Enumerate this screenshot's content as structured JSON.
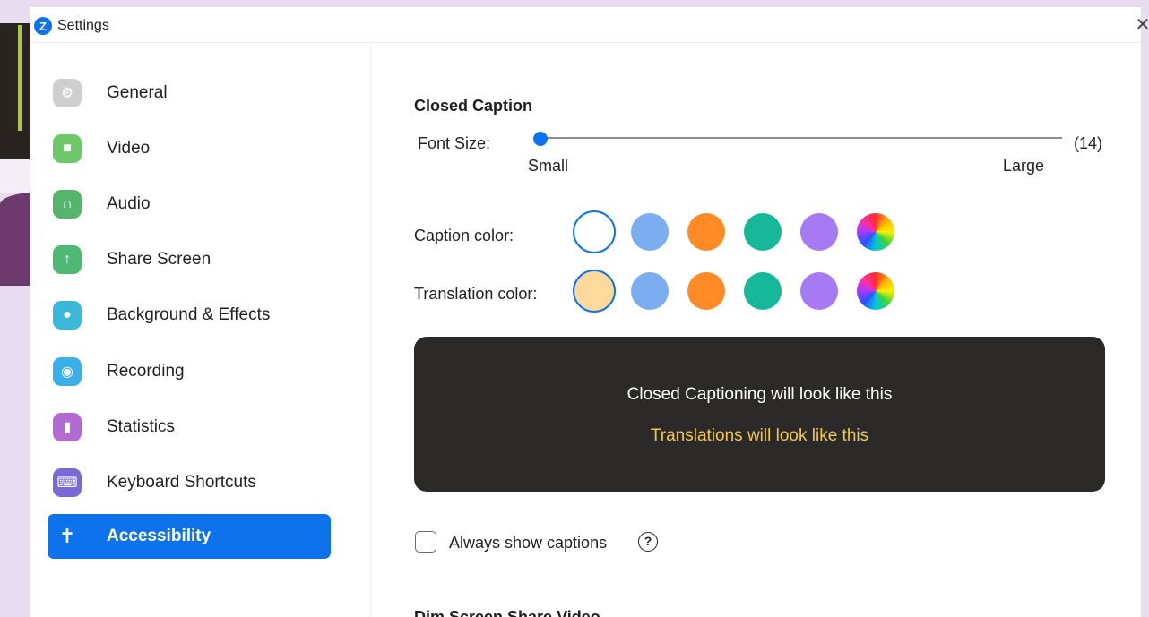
{
  "window": {
    "title": "Settings",
    "logo_letter": "Z",
    "close_glyph": "✕"
  },
  "sidebar": {
    "items": [
      {
        "label": "General",
        "icon": "gear-icon",
        "color": "#cfcfcf",
        "glyph": "⚙",
        "active": false
      },
      {
        "label": "Video",
        "icon": "video-camera-icon",
        "color": "#6dc86a",
        "glyph": "■",
        "active": false
      },
      {
        "label": "Audio",
        "icon": "headphones-icon",
        "color": "#56b56d",
        "glyph": "∩",
        "active": false
      },
      {
        "label": "Share Screen",
        "icon": "share-screen-icon",
        "color": "#4fb874",
        "glyph": "↑",
        "active": false
      },
      {
        "label": "Background & Effects",
        "icon": "background-person-icon",
        "color": "#3bb8d9",
        "glyph": "●",
        "active": false
      },
      {
        "label": "Recording",
        "icon": "recording-icon",
        "color": "#3ab0e8",
        "glyph": "◉",
        "active": false
      },
      {
        "label": "Statistics",
        "icon": "statistics-icon",
        "color": "#b36ad2",
        "glyph": "▮",
        "active": false
      },
      {
        "label": "Keyboard Shortcuts",
        "icon": "keyboard-icon",
        "color": "#7b6ad6",
        "glyph": "⌨",
        "active": false
      },
      {
        "label": "Accessibility",
        "icon": "accessibility-icon",
        "color": "#0e72ed",
        "glyph": "✝",
        "active": true
      }
    ]
  },
  "main": {
    "closed_caption": {
      "title": "Closed Caption",
      "font_size_label": "Font Size:",
      "font_size_value": "(14)",
      "slider_min_label": "Small",
      "slider_max_label": "Large",
      "slider_position": 0.0
    },
    "caption_color": {
      "label": "Caption color:",
      "swatches": [
        "#ffffff",
        "#7aaef0",
        "#ff8a26",
        "#16b89a",
        "#a67af4",
        "rainbow"
      ],
      "selected_index": 0
    },
    "translation_color": {
      "label": "Translation color:",
      "swatches": [
        "#fdd99b",
        "#7aaef0",
        "#ff8a26",
        "#16b89a",
        "#a67af4",
        "rainbow"
      ],
      "selected_index": 0
    },
    "preview": {
      "caption_text": "Closed Captioning will look like this",
      "translation_text": "Translations will look like this",
      "caption_text_color": "#ffffff",
      "translation_text_color": "#f1c84b"
    },
    "always_show_captions": {
      "label": "Always show captions",
      "checked": false,
      "help_glyph": "?"
    },
    "next_section_title": "Dim Screen Share Video"
  }
}
